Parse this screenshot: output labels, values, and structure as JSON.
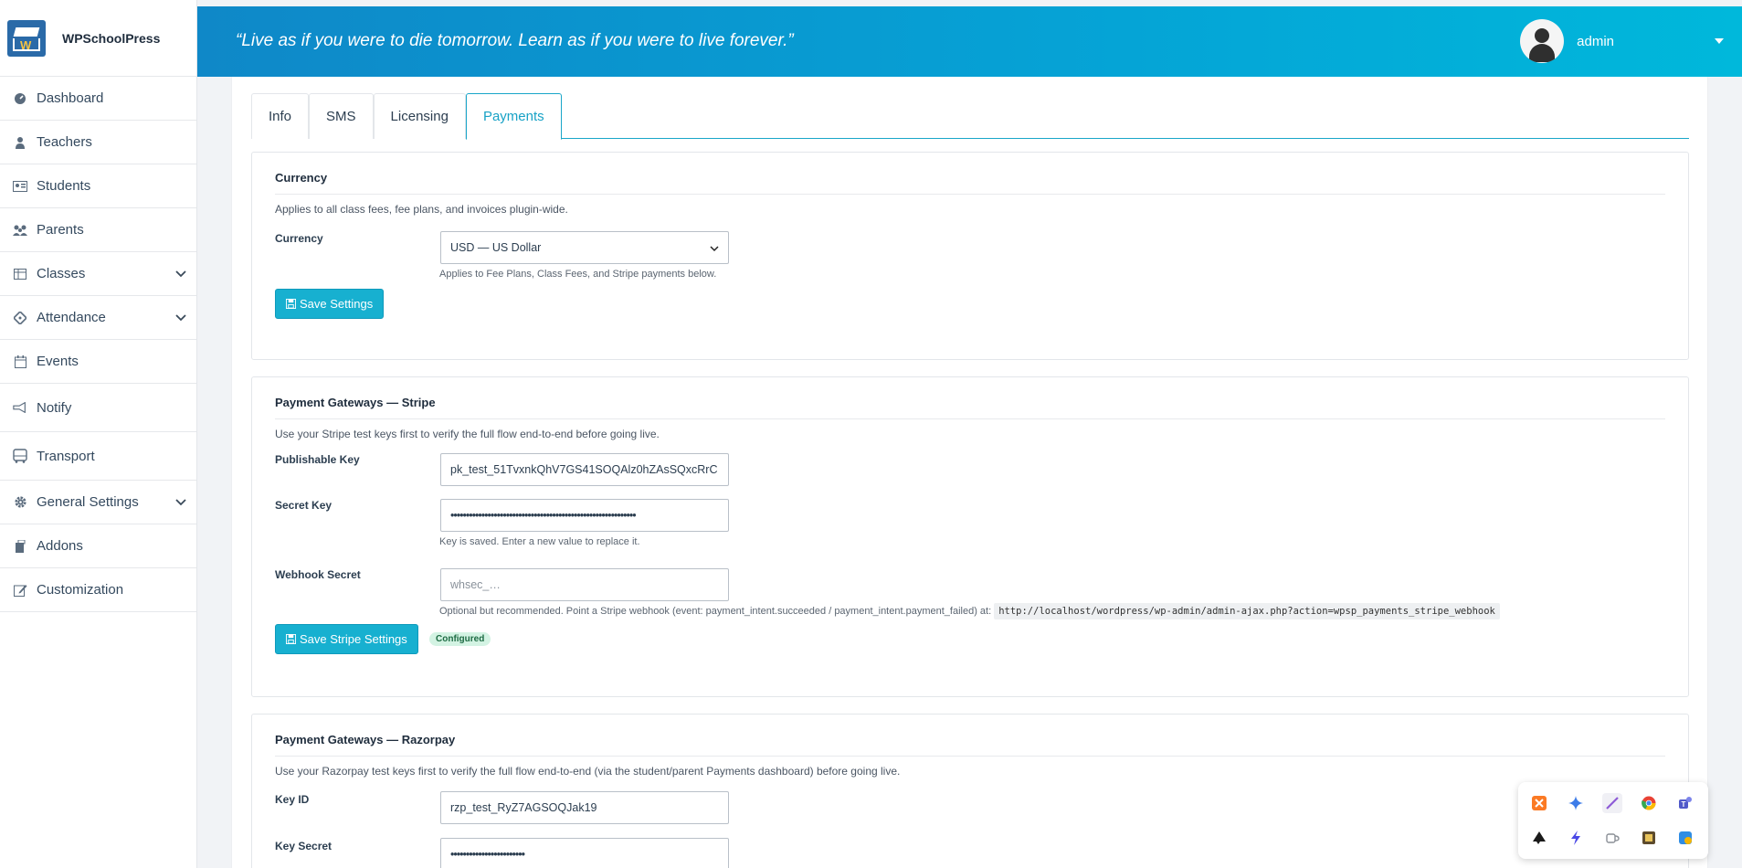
{
  "app": {
    "name": "WPSchoolPress"
  },
  "header": {
    "quote": "“Live as if you were to die tomorrow. Learn as if you were to live forever.”",
    "user": "admin"
  },
  "sidebar": {
    "items": [
      {
        "label": "Dashboard",
        "icon": "dashboard-icon"
      },
      {
        "label": "Teachers",
        "icon": "teacher-icon"
      },
      {
        "label": "Students",
        "icon": "students-icon"
      },
      {
        "label": "Parents",
        "icon": "parents-icon"
      },
      {
        "label": "Classes",
        "icon": "classes-icon"
      },
      {
        "label": "Attendance",
        "icon": "attendance-icon"
      },
      {
        "label": "Events",
        "icon": "calendar-icon"
      },
      {
        "label": "Notify",
        "icon": "megaphone-icon"
      },
      {
        "label": "Transport",
        "icon": "bus-icon"
      },
      {
        "label": "General Settings",
        "icon": "gear-icon"
      },
      {
        "label": "Addons",
        "icon": "addons-icon"
      },
      {
        "label": "Customization",
        "icon": "edit-icon"
      }
    ]
  },
  "tabs": [
    {
      "label": "Info"
    },
    {
      "label": "SMS"
    },
    {
      "label": "Licensing"
    },
    {
      "label": "Payments"
    }
  ],
  "currency": {
    "title": "Currency",
    "desc": "Applies to all class fees, fee plans, and invoices plugin-wide.",
    "label": "Currency",
    "selected": "USD — US Dollar",
    "help": "Applies to Fee Plans, Class Fees, and Stripe payments below.",
    "save": "Save Settings"
  },
  "stripe": {
    "title": "Payment Gateways — Stripe",
    "desc": "Use your Stripe test keys first to verify the full flow end-to-end before going live.",
    "pub_label": "Publishable Key",
    "pub_value": "pk_test_51TvxnkQhV7GS41SOQAlz0hZAsSQxcRrC",
    "secret_label": "Secret Key",
    "secret_value": "••••••••••••••••••••••••••••••••••••••••••••••••••••••••••••",
    "secret_help": "Key is saved. Enter a new value to replace it.",
    "webhook_label": "Webhook Secret",
    "webhook_placeholder": "whsec_…",
    "webhook_help": "Optional but recommended. Point a Stripe webhook (event: payment_intent.succeeded / payment_intent.payment_failed) at:",
    "webhook_url": "http://localhost/wordpress/wp-admin/admin-ajax.php?action=wpsp_payments_stripe_webhook",
    "save": "Save Stripe Settings",
    "status": "Configured"
  },
  "razorpay": {
    "title": "Payment Gateways — Razorpay",
    "desc": "Use your Razorpay test keys first to verify the full flow end-to-end (via the student/parent Payments dashboard) before going live.",
    "keyid_label": "Key ID",
    "keyid_value": "rzp_test_RyZ7AGSOQJak19",
    "secret_label": "Key Secret",
    "secret_value": "••••••••••••••••••••••••"
  },
  "widget": {
    "icons": [
      "xampp-icon",
      "gemini-icon",
      "feather-icon",
      "chrome-icon",
      "teams-icon",
      "inkscape-icon",
      "lightning-icon",
      "mug-icon",
      "film-icon",
      "shield-app-icon"
    ]
  },
  "colors": {
    "accent": "#17b0d0",
    "header_from": "#0f88c8",
    "header_to": "#00b8db",
    "badge_bg": "#d3f3e3"
  }
}
